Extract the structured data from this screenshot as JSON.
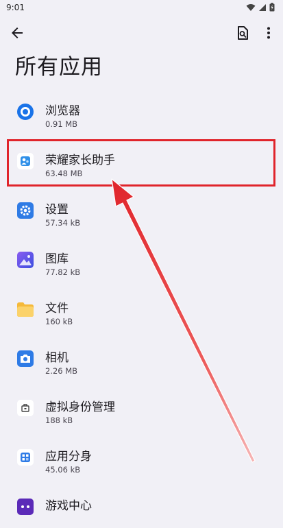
{
  "status_bar": {
    "time": "9:01"
  },
  "toolbar": {
    "back_icon": "arrow-back-icon",
    "search_icon": "search-document-icon",
    "more_icon": "more-vertical-icon"
  },
  "page": {
    "title": "所有应用"
  },
  "apps": [
    {
      "name": "浏览器",
      "size": "0.91 MB",
      "icon": "browser-icon",
      "color": "#1a73e8"
    },
    {
      "name": "荣耀家长助手",
      "size": "63.48 MB",
      "icon": "parent-assistant-icon",
      "color": "#2f8fe8"
    },
    {
      "name": "设置",
      "size": "57.34 kB",
      "icon": "settings-icon",
      "color": "#2f7be5"
    },
    {
      "name": "图库",
      "size": "77.82 kB",
      "icon": "gallery-icon",
      "color": "#6a4fe0"
    },
    {
      "name": "文件",
      "size": "160 kB",
      "icon": "files-icon",
      "color": "#f5b93a"
    },
    {
      "name": "相机",
      "size": "2.26 MB",
      "icon": "camera-icon",
      "color": "#2e7be6"
    },
    {
      "name": "虚拟身份管理",
      "size": "188 kB",
      "icon": "virtual-identity-icon",
      "color": "#444444"
    },
    {
      "name": "应用分身",
      "size": "45.06 kB",
      "icon": "app-clone-icon",
      "color": "#2e7be6"
    },
    {
      "name": "游戏中心",
      "size": "",
      "icon": "game-center-icon",
      "color": "#5b2ab8"
    }
  ],
  "annotation": {
    "highlight_color": "#e0242b",
    "arrow_color": "#e0242b"
  }
}
